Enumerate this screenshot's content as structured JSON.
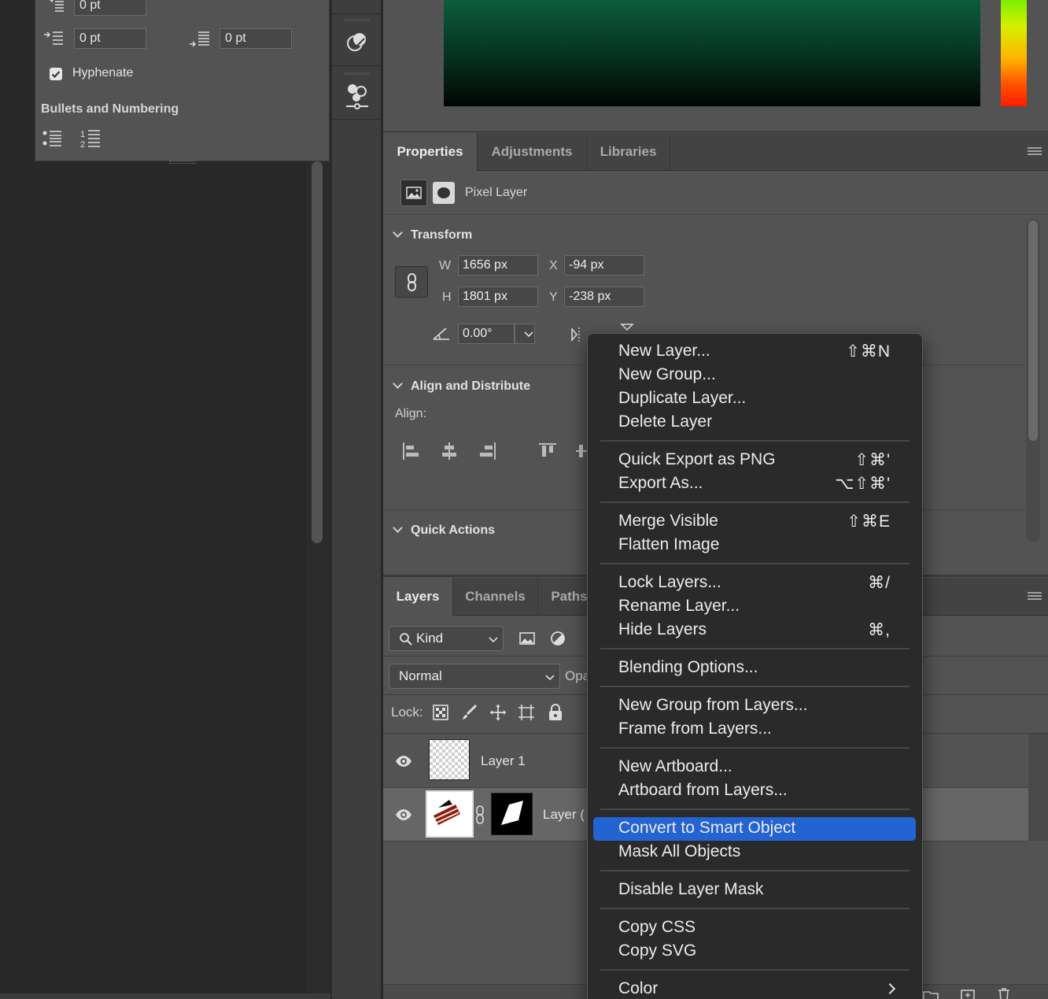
{
  "paragraph_panel": {
    "top_field_value": "0 pt",
    "indent_left_last_value": "0 pt",
    "space_after_value": "0 pt",
    "hyphenate_label": "Hyphenate",
    "hyphenate_checked": true,
    "bullets_title": "Bullets and Numbering"
  },
  "properties": {
    "tabs": [
      "Properties",
      "Adjustments",
      "Libraries"
    ],
    "active_tab": "Properties",
    "layer_kind": "Pixel Layer",
    "transform_title": "Transform",
    "w_label": "W",
    "w_value": "1656 px",
    "x_label": "X",
    "x_value": "-94 px",
    "h_label": "H",
    "h_value": "1801 px",
    "y_label": "Y",
    "y_value": "-238 px",
    "angle_value": "0.00°",
    "align_title": "Align and Distribute",
    "align_label": "Align:",
    "quick_actions_title": "Quick Actions"
  },
  "layers": {
    "tabs": [
      "Layers",
      "Channels",
      "Paths"
    ],
    "active_tab": "Layers",
    "kind_filter": "Kind",
    "blend_mode": "Normal",
    "opacity_label_partial": "Opa",
    "lock_label": "Lock:",
    "items": [
      {
        "name": "Layer 1",
        "visible": true
      },
      {
        "name": "Layer (",
        "visible": true,
        "selected": true
      }
    ]
  },
  "context_menu": {
    "groups": [
      [
        {
          "label": "New Layer...",
          "shortcut": "⇧⌘N"
        },
        {
          "label": "New Group...",
          "shortcut": ""
        },
        {
          "label": "Duplicate Layer...",
          "shortcut": ""
        },
        {
          "label": "Delete Layer",
          "shortcut": ""
        }
      ],
      [
        {
          "label": "Quick Export as PNG",
          "shortcut": "⇧⌘'"
        },
        {
          "label": "Export As...",
          "shortcut": "⌥⇧⌘'"
        }
      ],
      [
        {
          "label": "Merge Visible",
          "shortcut": "⇧⌘E"
        },
        {
          "label": "Flatten Image",
          "shortcut": ""
        }
      ],
      [
        {
          "label": "Lock Layers...",
          "shortcut": "⌘/"
        },
        {
          "label": "Rename Layer...",
          "shortcut": ""
        },
        {
          "label": "Hide Layers",
          "shortcut": "⌘,"
        }
      ],
      [
        {
          "label": "Blending Options...",
          "shortcut": ""
        }
      ],
      [
        {
          "label": "New Group from Layers...",
          "shortcut": ""
        },
        {
          "label": "Frame from Layers...",
          "shortcut": ""
        }
      ],
      [
        {
          "label": "New Artboard...",
          "shortcut": ""
        },
        {
          "label": "Artboard from Layers...",
          "shortcut": ""
        }
      ],
      [
        {
          "label": "Convert to Smart Object",
          "shortcut": "",
          "highlighted": true
        },
        {
          "label": "Mask All Objects",
          "shortcut": ""
        }
      ],
      [
        {
          "label": "Disable Layer Mask",
          "shortcut": ""
        }
      ],
      [
        {
          "label": "Copy CSS",
          "shortcut": ""
        },
        {
          "label": "Copy SVG",
          "shortcut": ""
        }
      ],
      [
        {
          "label": "Color",
          "shortcut": "",
          "submenu": true
        }
      ]
    ]
  },
  "colors": {
    "highlight": "#2463d2",
    "panel_bg": "#535353",
    "menu_bg": "#2a2a2a"
  }
}
